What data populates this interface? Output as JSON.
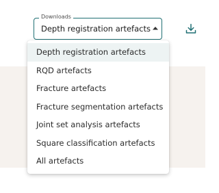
{
  "downloads": {
    "legend": "Downloads",
    "selected_value": "Depth registration artefacts",
    "options": [
      "Depth registration artefacts",
      "RQD artefacts",
      "Fracture artefacts",
      "Fracture segmentation artefacts",
      "Joint set analysis artefacts",
      "Square classification artefacts",
      "All artefacts"
    ]
  },
  "icons": {
    "caret": "caret-up-icon",
    "download": "download-icon"
  },
  "colors": {
    "accent": "#1f6f73",
    "selected_option_bg": "#edf3f3",
    "panel_bg": "#f6f2ee"
  }
}
